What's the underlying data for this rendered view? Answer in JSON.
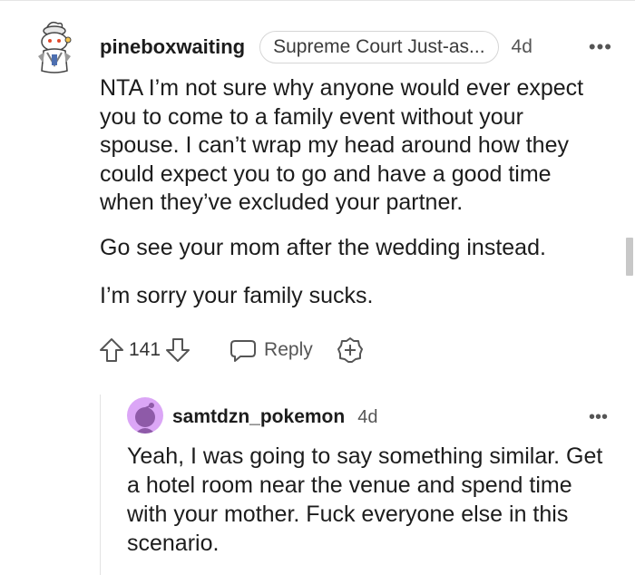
{
  "comment": {
    "username": "pineboxwaiting",
    "flair": "Supreme Court Just-as...",
    "time": "4d",
    "more": "•••",
    "paragraphs": [
      "NTA I’m not sure why anyone would ever expect you to come to a family event without your spouse. I can’t wrap my head around how they could expect you to go and have a good time when they’ve excluded your partner.",
      "Go see your mom after the wedding instead.",
      "I’m sorry your family sucks."
    ],
    "score": "141",
    "reply_label": "Reply"
  },
  "reply": {
    "username": "samtdzn_pokemon",
    "time": "4d",
    "more": "•••",
    "body": "Yeah, I was going to say something similar. Get a hotel room near the venue and spend time with your mother. Fuck everyone else in this scenario."
  },
  "colors": {
    "reply_avatar_bg": "#dba6f6",
    "reply_avatar_figure": "#8e5aa8",
    "text": "#1c1c1c",
    "muted": "#555555"
  }
}
